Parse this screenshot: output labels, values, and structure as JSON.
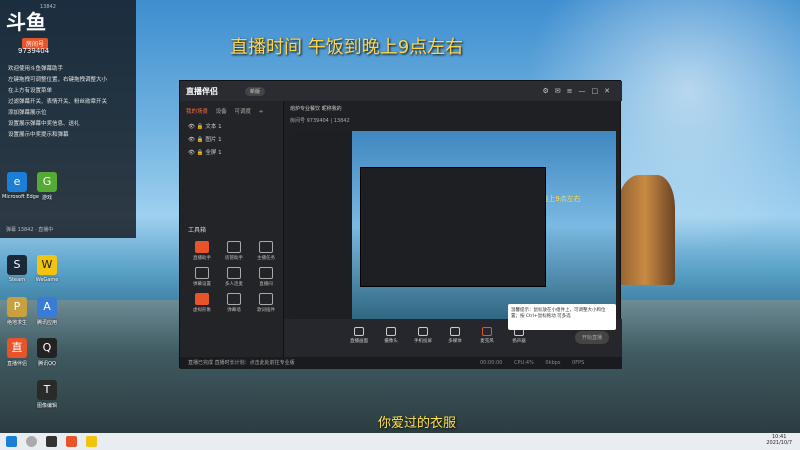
{
  "overlay": {
    "title": "直播时间  午饭到晚上9点左右",
    "subtitle": "你爱过的衣服"
  },
  "chat": {
    "logo": "斗鱼",
    "room_badge": "房间号",
    "room_id": "9739404",
    "top_text": "13842",
    "lines": [
      "欢迎使用斗鱼弹幕助手",
      "左键拖拽可调整位置，右键拖拽调整大小",
      "在上方有设置菜单",
      "过滤弹幕开关、表情开关、粉丝勋章开关",
      "添加弹幕展示位",
      "设置展示弹幕中奖信息、送礼",
      "设置展示中奖提示和弹幕"
    ],
    "bottom_text": "弹幕 13842 · 直播中"
  },
  "desktop_icons": [
    {
      "label": "Microsoft Edge",
      "glyph": "e",
      "color": "#1b7fd8"
    },
    {
      "label": "Steam",
      "glyph": "S",
      "color": "#1b2838"
    },
    {
      "label": "WeGame",
      "glyph": "W",
      "color": "#f1c40f"
    },
    {
      "label": "腾讯QQ",
      "glyph": "Q",
      "color": "#222"
    },
    {
      "label": "直播伴侣",
      "glyph": "直",
      "color": "#e8542a"
    },
    {
      "label": "腾讯应用",
      "glyph": "A",
      "color": "#3a7bd5"
    },
    {
      "label": "游戏",
      "glyph": "G",
      "color": "#5a3"
    },
    {
      "label": "绝地求生",
      "glyph": "P",
      "color": "#c8a040"
    },
    {
      "label": "图像编辑",
      "glyph": "T",
      "color": "#2a2a2a"
    }
  ],
  "window": {
    "app_name": "直播伴侣",
    "version_badge": "新版",
    "tabs": [
      "我的场景",
      "设备",
      "可调度",
      "+"
    ],
    "scenes": [
      "文本 1",
      "图片 1",
      "全屏 1"
    ],
    "tools_title": "工具箱",
    "tools": [
      {
        "label": "直播助手",
        "red": true
      },
      {
        "label": "房管助手",
        "red": false
      },
      {
        "label": "主播任务",
        "red": false
      },
      {
        "label": "弹幕设置",
        "red": false
      },
      {
        "label": "多人连麦",
        "red": false
      },
      {
        "label": "直播间",
        "red": false
      },
      {
        "label": "虚拟形象",
        "red": false
      },
      {
        "label": "弹幕墙",
        "red": false
      },
      {
        "label": "歌词插件",
        "red": false
      }
    ],
    "main_info": "熔炉专业餐饮  昵称我的",
    "main_info2": "房间号 9739404  |  13842",
    "preview_title": "直播时间  午饭到晚上9点左右",
    "bottom_actions": [
      "直播画面",
      "摄像头",
      "手机投屏",
      "多媒体",
      "麦克风",
      "扬声器"
    ],
    "start_label": "开始直播",
    "status_text": "直播已完成 直播时长计划：点击此处前往专业版",
    "status_right": "00:00:00  CPU:4%  0kbps  0FPS",
    "tooltip": "温馨提示：鼠标放在小组件上，可调整大小和位置；按 Ctrl+鼠标拖动 可多选"
  },
  "taskbar": {
    "time": "10:41",
    "date": "2021/10/7"
  }
}
